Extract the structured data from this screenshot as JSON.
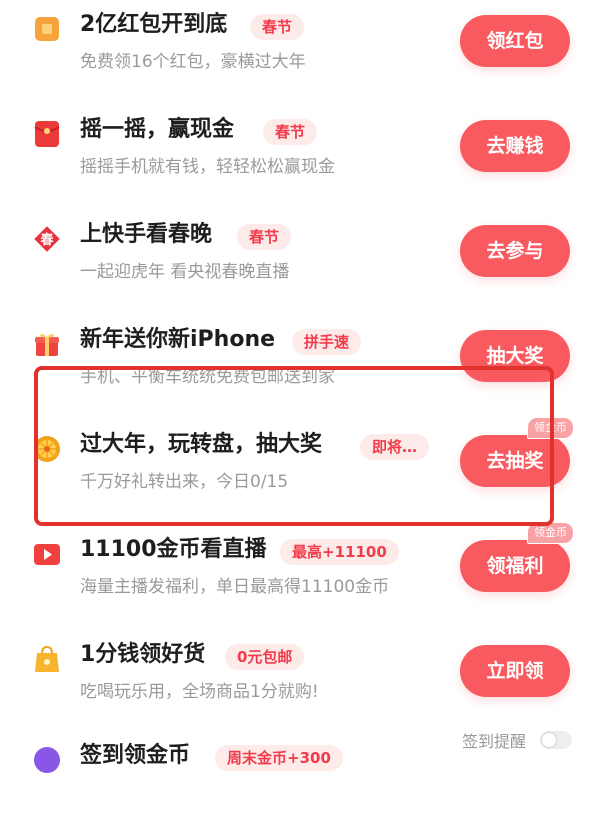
{
  "tasks": [
    {
      "title": "2亿红包开到底",
      "tag": "春节",
      "subtitle": "免费领16个红包，豪横过大年",
      "button": "领红包",
      "icon": "red-envelope-icon"
    },
    {
      "title": "摇一摇，赢现金",
      "tag": "春节",
      "subtitle": "摇摇手机就有钱，轻轻松松赢现金",
      "button": "去赚钱",
      "icon": "red-packet-icon"
    },
    {
      "title": "上快手看春晚",
      "tag": "春节",
      "subtitle": "一起迎虎年 看央视春晚直播",
      "button": "去参与",
      "icon": "spring-festival-icon",
      "icon_text": "春"
    },
    {
      "title": "新年送你新iPhone",
      "tag": "拼手速",
      "subtitle": "手机、平衡车统统免费包邮送到家",
      "button": "抽大奖",
      "icon": "gift-icon"
    },
    {
      "title": "过大年，玩转盘，抽大奖",
      "tag": "即将…",
      "subtitle": "千万好礼转出来，今日0/15",
      "button": "去抽奖",
      "badge": "领金币",
      "icon": "lucky-wheel-icon"
    },
    {
      "title": "11100金币看直播",
      "tag": "最高+11100",
      "subtitle": "海量主播发福利，单日最高得11100金币",
      "button": "领福利",
      "badge": "领金币",
      "icon": "live-stream-icon"
    },
    {
      "title": "1分钱领好货",
      "tag": "0元包邮",
      "subtitle": "吃喝玩乐用，全场商品1分就购!",
      "button": "立即领",
      "icon": "shopping-bag-icon"
    },
    {
      "title": "签到领金币",
      "tag": "周末金币+300",
      "icon": "checkin-icon"
    }
  ],
  "checkin_reminder": {
    "label": "签到提醒",
    "enabled": false
  },
  "colors": {
    "accent": "#f85a5f",
    "tag_bg": "#fdebea",
    "tag_text": "#f23c4b",
    "highlight_border": "#e1322e"
  }
}
